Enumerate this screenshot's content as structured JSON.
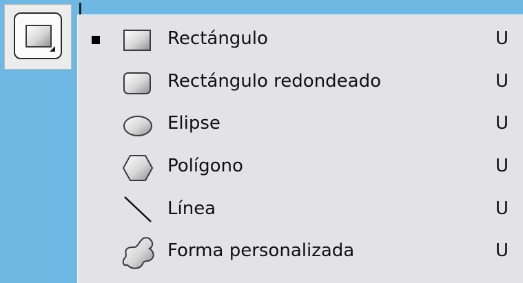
{
  "toolbar": {
    "active_tool_icon": "rectangle-tool-icon"
  },
  "menu": {
    "items": [
      {
        "label": "Rectángulo",
        "shortcut": "U",
        "icon": "rectangle-icon",
        "selected": true
      },
      {
        "label": "Rectángulo redondeado",
        "shortcut": "U",
        "icon": "rounded-rectangle-icon",
        "selected": false
      },
      {
        "label": "Elipse",
        "shortcut": "U",
        "icon": "ellipse-icon",
        "selected": false
      },
      {
        "label": "Polígono",
        "shortcut": "U",
        "icon": "polygon-icon",
        "selected": false
      },
      {
        "label": "Línea",
        "shortcut": "U",
        "icon": "line-icon",
        "selected": false
      },
      {
        "label": "Forma personalizada",
        "shortcut": "U",
        "icon": "custom-shape-icon",
        "selected": false
      }
    ]
  },
  "colors": {
    "background": "#6fb8e3",
    "menu_bg": "#e3e2e5",
    "text": "#101010"
  }
}
